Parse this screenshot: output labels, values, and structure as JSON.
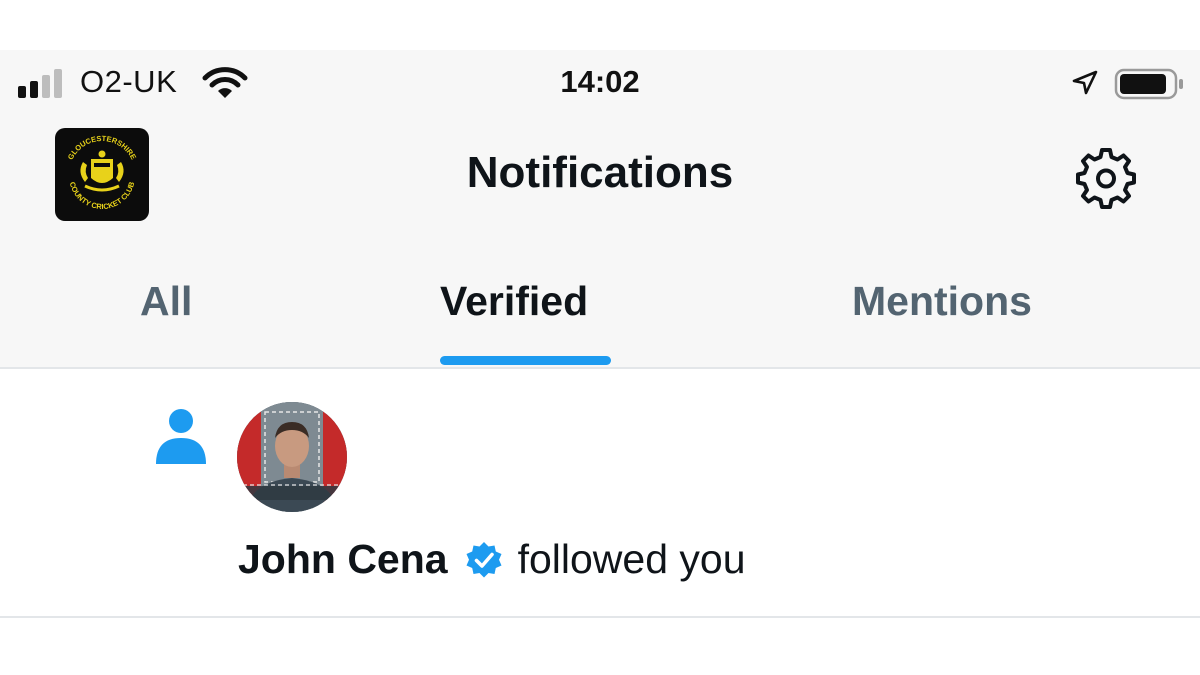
{
  "status_bar": {
    "carrier": "O2-UK",
    "time": "14:02",
    "signal_bars_active": 2,
    "signal_bars_total": 4,
    "battery_level": 0.85
  },
  "header": {
    "title": "Notifications",
    "logo_icon": "gloucestershire-ccc-logo",
    "settings_icon": "gear-icon"
  },
  "tabs": [
    {
      "label": "All",
      "active": false
    },
    {
      "label": "Verified",
      "active": true
    },
    {
      "label": "Mentions",
      "active": false
    }
  ],
  "notification": {
    "icon": "person-icon",
    "user_name": "John Cena",
    "verified": true,
    "action_text": "followed you"
  },
  "colors": {
    "accent": "#1d9bf0",
    "text_primary": "#0f1419",
    "text_secondary": "#536471",
    "logo_gold": "#e8d21a"
  }
}
